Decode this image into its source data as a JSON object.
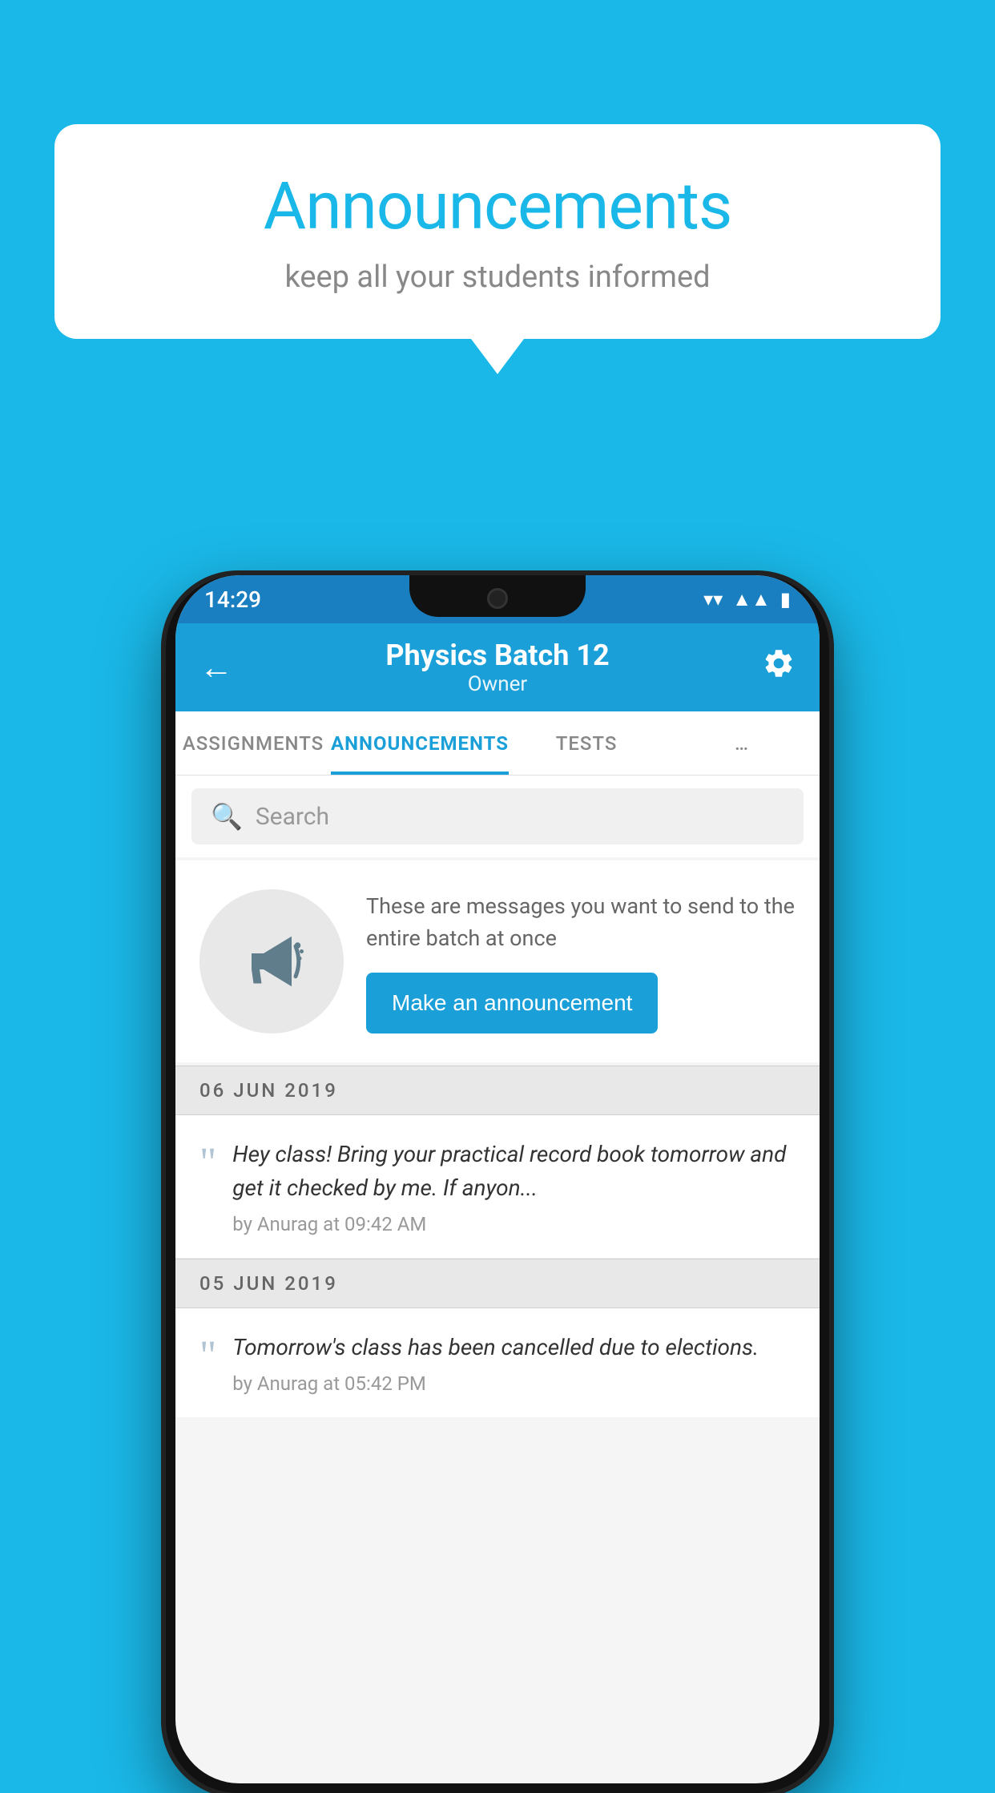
{
  "bubble": {
    "title": "Announcements",
    "subtitle": "keep all your students informed"
  },
  "statusBar": {
    "time": "14:29"
  },
  "header": {
    "title": "Physics Batch 12",
    "subtitle": "Owner",
    "back_label": "←",
    "settings_label": "⚙"
  },
  "tabs": [
    {
      "label": "ASSIGNMENTS",
      "active": false
    },
    {
      "label": "ANNOUNCEMENTS",
      "active": true
    },
    {
      "label": "TESTS",
      "active": false
    },
    {
      "label": "…",
      "active": false
    }
  ],
  "search": {
    "placeholder": "Search"
  },
  "prompt": {
    "text": "These are messages you want to send to the entire batch at once",
    "button_label": "Make an announcement"
  },
  "announcements": [
    {
      "date": "06  JUN  2019",
      "text": "Hey class! Bring your practical record book tomorrow and get it checked by me. If anyon...",
      "meta": "by Anurag at 09:42 AM"
    },
    {
      "date": "05  JUN  2019",
      "text": "Tomorrow's class has been cancelled due to elections.",
      "meta": "by Anurag at 05:42 PM"
    }
  ],
  "colors": {
    "primary": "#1a9fd8",
    "background": "#1ab8e8",
    "white": "#ffffff"
  }
}
